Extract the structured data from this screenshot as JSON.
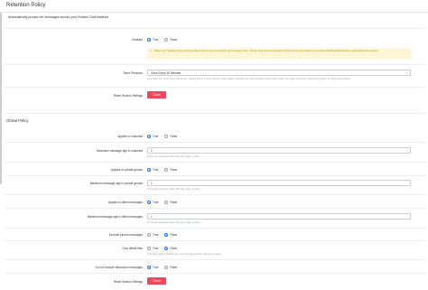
{
  "header": {
    "title": "Retention Policy"
  },
  "description": "Automatically prunes old messages across your Rocket.Chat instance.",
  "top": {
    "enabled": {
      "label": "Enabled",
      "true_label": "True",
      "false_label": "False",
      "selected": "true"
    },
    "warning": "Watch out! Tweaking these settings without utmost care can destroy all message history. Please read the documentation before turning the feature on at rocket.chat/docs/administrator-guides/retention-policies/",
    "timer_precision": {
      "label": "Timer Precision",
      "value": "Once Every 30 Minutes",
      "hint": "How often the prune timer should run. Setting this to a more precise value makes channels with fast retention timers work better, but might cost extra processing power on large communities."
    },
    "reset_label": "Reset Section Settings",
    "reset_button": "Reset"
  },
  "global_policy": {
    "title": "Global Policy",
    "rows": [
      {
        "type": "radio",
        "label": "Applies to channels",
        "true_label": "True",
        "false_label": "False",
        "selected": "true"
      },
      {
        "type": "input",
        "label": "Maximum message age in channels",
        "value": "1",
        "hint": "Prune all messages older than this value, in days."
      },
      {
        "type": "radio",
        "label": "Applies to private groups",
        "true_label": "True",
        "false_label": "False",
        "selected": "true"
      },
      {
        "type": "input",
        "label": "Maximum message age in private groups",
        "value": "1",
        "hint": "Prune all messages older than this value, in days."
      },
      {
        "type": "radio",
        "label": "Applies to direct messages",
        "true_label": "True",
        "false_label": "False",
        "selected": "true"
      },
      {
        "type": "input",
        "label": "Maximum message age in direct messages",
        "value": "1",
        "hint": "Prune all messages older than this value, in days."
      },
      {
        "type": "radio",
        "label": "Exclude pinned messages",
        "true_label": "True",
        "false_label": "False",
        "selected": "false"
      },
      {
        "type": "radio",
        "label": "Only delete files",
        "true_label": "True",
        "false_label": "False",
        "selected": "false",
        "hint": "Only files will be deleted, the messages themselves will stay in place."
      },
      {
        "type": "radio",
        "label": "Do not exclude discussion messages",
        "true_label": "True",
        "false_label": "False",
        "selected": "true"
      }
    ],
    "reset_label": "Reset Section Settings",
    "reset_button": "Reset"
  }
}
